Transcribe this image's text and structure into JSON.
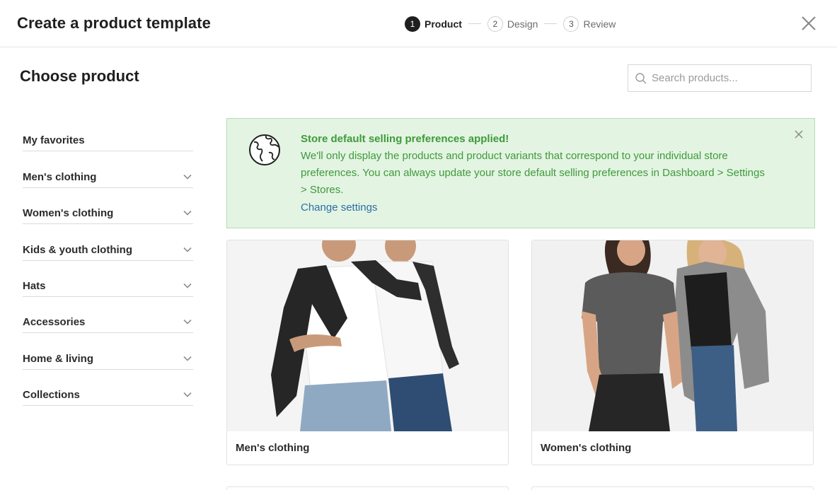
{
  "header": {
    "title": "Create a product template",
    "steps": [
      {
        "number": "1",
        "label": "Product",
        "active": true
      },
      {
        "number": "2",
        "label": "Design",
        "active": false
      },
      {
        "number": "3",
        "label": "Review",
        "active": false
      }
    ],
    "close_icon": "close-icon"
  },
  "main": {
    "title": "Choose product",
    "search": {
      "placeholder": "Search products...",
      "value": "",
      "icon": "search-icon"
    }
  },
  "sidebar": {
    "items": [
      {
        "label": "My favorites",
        "expandable": false
      },
      {
        "label": "Men's clothing",
        "expandable": true
      },
      {
        "label": "Women's clothing",
        "expandable": true
      },
      {
        "label": "Kids & youth clothing",
        "expandable": true
      },
      {
        "label": "Hats",
        "expandable": true
      },
      {
        "label": "Accessories",
        "expandable": true
      },
      {
        "label": "Home & living",
        "expandable": true
      },
      {
        "label": "Collections",
        "expandable": true
      }
    ]
  },
  "notice": {
    "icon": "globe-icon",
    "title": "Store default selling preferences applied!",
    "body": "We'll only display the products and product variants that correspond to your individual store preferences. You can always update your store default selling preferences in Dashboard > Settings > Stores.",
    "link": "Change settings",
    "colors": {
      "background": "#e3f4e2",
      "text": "#3f9a3b",
      "link": "#2c6ea5"
    }
  },
  "products": [
    {
      "label": "Men's clothing"
    },
    {
      "label": "Women's clothing"
    }
  ]
}
